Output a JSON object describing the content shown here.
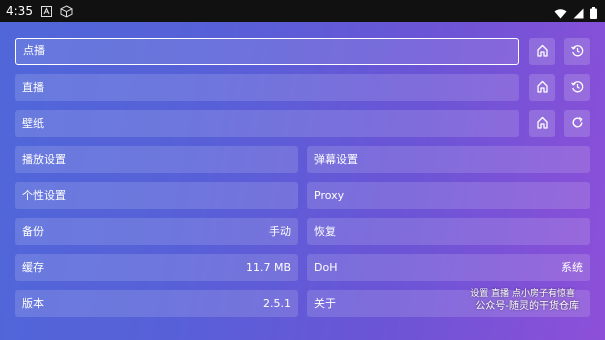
{
  "status_bar": {
    "time": "4:35",
    "icons": [
      "a-box-icon",
      "cube-icon",
      "wifi-icon",
      "signal-icon",
      "battery-icon"
    ]
  },
  "search_rows": [
    {
      "label": "点播",
      "actions": [
        "home-icon",
        "history-icon"
      ]
    },
    {
      "label": "直播",
      "actions": [
        "home-icon",
        "history-icon"
      ]
    },
    {
      "label": "壁纸",
      "actions": [
        "home-icon",
        "refresh-icon"
      ]
    }
  ],
  "settings": {
    "left": [
      {
        "label": "播放设置",
        "value": ""
      },
      {
        "label": "个性设置",
        "value": ""
      },
      {
        "label": "备份",
        "value": "手动"
      },
      {
        "label": "缓存",
        "value": "11.7 MB"
      },
      {
        "label": "版本",
        "value": "2.5.1"
      }
    ],
    "right": [
      {
        "label": "弹幕设置",
        "value": ""
      },
      {
        "label": "Proxy",
        "value": ""
      },
      {
        "label": "恢复",
        "value": ""
      },
      {
        "label": "DoH",
        "value": "系统"
      },
      {
        "label": "关于",
        "value": ""
      }
    ]
  },
  "watermark": {
    "line1": "设置 直播 点小房子有惊喜",
    "line2": "公众号-随灵的干货仓库"
  }
}
